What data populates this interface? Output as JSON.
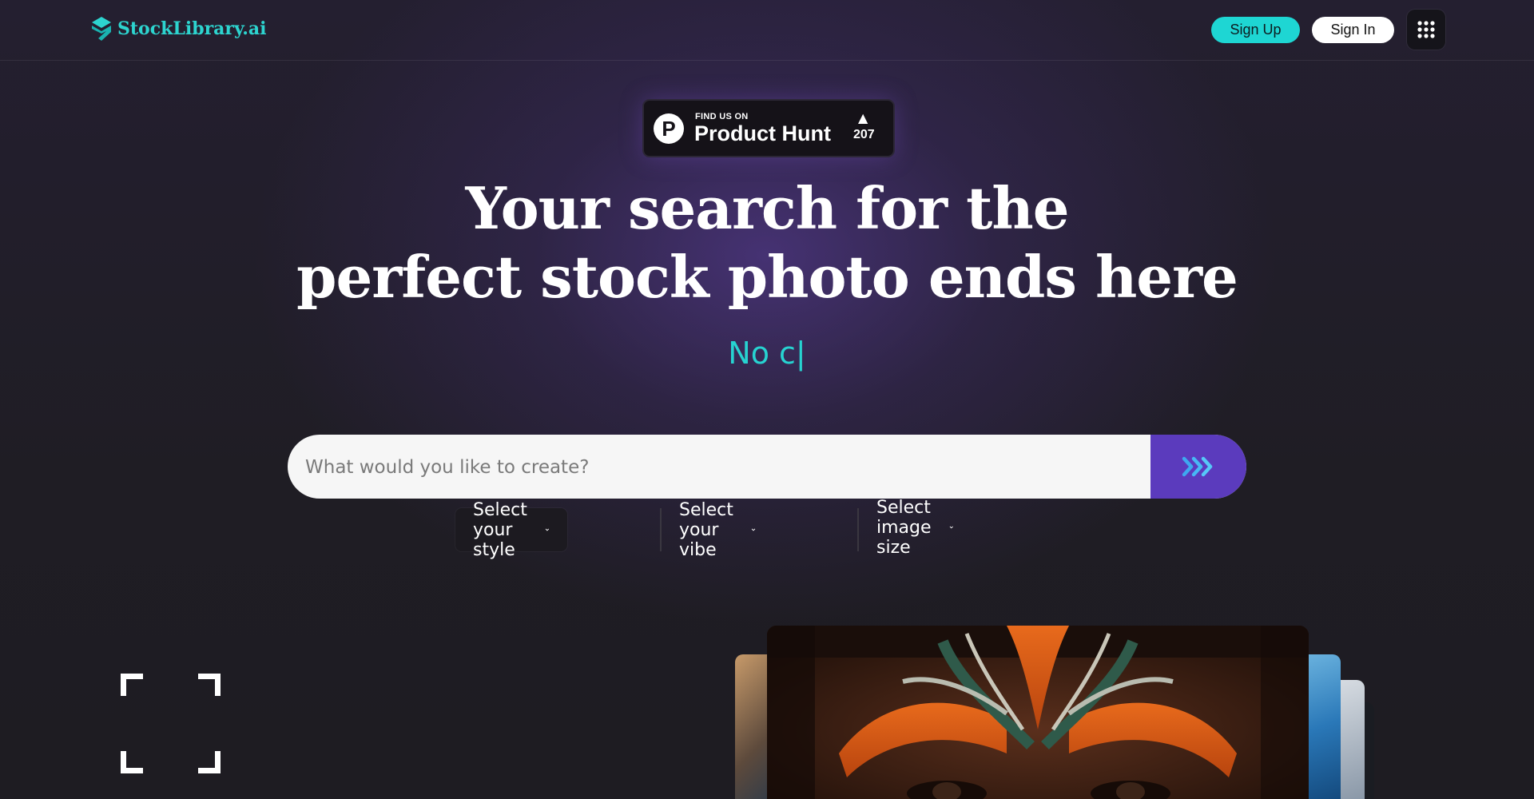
{
  "brand": {
    "name": "StockLibrary.ai",
    "accent": "#2dd4cf"
  },
  "header": {
    "signup_label": "Sign Up",
    "signin_label": "Sign In",
    "apps_icon": "grid-dots-icon"
  },
  "product_hunt": {
    "find_label": "FIND US ON",
    "name": "Product Hunt",
    "votes": "207"
  },
  "hero": {
    "title_line1": "Your search for the",
    "title_line2": "perfect stock photo ends here",
    "typed_text": "No c|"
  },
  "search": {
    "placeholder": "What would you like to create?",
    "button_icon": "triple-chevron-right-icon"
  },
  "filters": {
    "style_label": "Select your style",
    "vibe_label": "Select your vibe",
    "size_label": "Select image size"
  },
  "colors": {
    "primary_button": "#5b3bbd",
    "signup_bg": "#1ed6d3"
  }
}
